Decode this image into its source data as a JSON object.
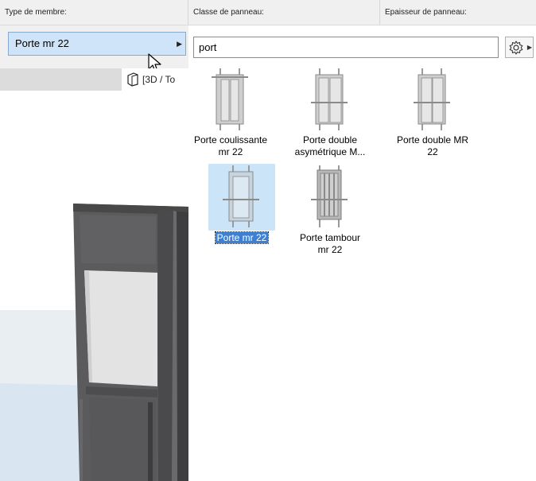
{
  "headers": {
    "member_type": "Type de membre:",
    "panel_class": "Classe de panneau:",
    "panel_thickness": "Epaisseur de panneau:"
  },
  "left": {
    "selected_member": "Porte mr 22",
    "view_tab": "[3D / To"
  },
  "search": {
    "value": "port"
  },
  "library_items": [
    {
      "label_line1": "Porte coulissante",
      "label_line2": "mr 22",
      "icon": "sliding-door-icon"
    },
    {
      "label_line1": "Porte double",
      "label_line2": "asymétrique M...",
      "icon": "double-door-asym-icon"
    },
    {
      "label_line1": "Porte double MR",
      "label_line2": "22",
      "icon": "double-door-icon"
    },
    {
      "label_line1": "Porte mr 22",
      "label_line2": "",
      "icon": "single-door-icon",
      "selected": true
    },
    {
      "label_line1": "Porte tambour",
      "label_line2": "mr 22",
      "icon": "revolving-door-icon"
    }
  ],
  "colors": {
    "selection": "#3d7fd3",
    "selection_bg": "#cce4f7",
    "door_dark": "#5a5a5c",
    "glass": "#e6e6e6"
  }
}
